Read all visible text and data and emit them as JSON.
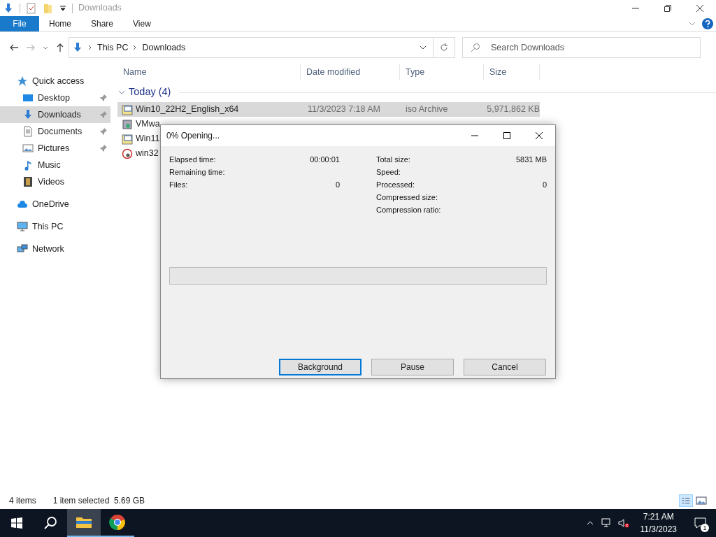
{
  "window": {
    "title": "Downloads"
  },
  "ribbon_tabs": [
    {
      "label": "File",
      "selected": true
    },
    {
      "label": "Home",
      "selected": false
    },
    {
      "label": "Share",
      "selected": false
    },
    {
      "label": "View",
      "selected": false
    }
  ],
  "breadcrumb": [
    "This PC",
    "Downloads"
  ],
  "search": {
    "placeholder": "Search Downloads"
  },
  "sidebar": {
    "items": [
      {
        "label": "Quick access",
        "kind": "star",
        "selected": false,
        "pinned": false,
        "children": [
          {
            "label": "Desktop",
            "kind": "desktop",
            "selected": false,
            "pinned": true
          },
          {
            "label": "Downloads",
            "kind": "download",
            "selected": true,
            "pinned": true
          },
          {
            "label": "Documents",
            "kind": "document",
            "selected": false,
            "pinned": true
          },
          {
            "label": "Pictures",
            "kind": "pictures",
            "selected": false,
            "pinned": true
          },
          {
            "label": "Music",
            "kind": "music",
            "selected": false,
            "pinned": false
          },
          {
            "label": "Videos",
            "kind": "video",
            "selected": false,
            "pinned": false
          }
        ]
      },
      {
        "label": "OneDrive",
        "kind": "cloud",
        "selected": false,
        "pinned": false
      },
      {
        "label": "This PC",
        "kind": "pc",
        "selected": false,
        "pinned": false
      },
      {
        "label": "Network",
        "kind": "network",
        "selected": false,
        "pinned": false
      }
    ]
  },
  "table": {
    "columns": [
      "Name",
      "Date modified",
      "Type",
      "Size"
    ],
    "group": "Today (4)",
    "rows": [
      {
        "kind": "iso",
        "selected": true,
        "cells": [
          "Win10_22H2_English_x64",
          "11/3/2023 7:18 AM",
          "iso Archive",
          "5,971,862 KB"
        ]
      },
      {
        "kind": "app",
        "selected": false,
        "cells": [
          "VMwa"
        ]
      },
      {
        "kind": "iso",
        "selected": false,
        "cells": [
          "Win11"
        ]
      },
      {
        "kind": "disk",
        "selected": false,
        "cells": [
          "win32"
        ]
      }
    ]
  },
  "status_bar": {
    "items": "4 items",
    "selection": "1 item selected  5.69 GB"
  },
  "dialog": {
    "title": "0% Opening...",
    "left": [
      {
        "label": "Elapsed time:",
        "value": "00:00:01"
      },
      {
        "label": "Remaining time:"
      },
      {
        "label": "Files:",
        "value": "0"
      }
    ],
    "right": [
      {
        "label": "Total size:",
        "value": "5831 MB"
      },
      {
        "label": "Speed:"
      },
      {
        "label": "Processed:",
        "value": "0"
      },
      {
        "label": "Compressed size:"
      },
      {
        "label": "Compression ratio:"
      }
    ],
    "progress": {
      "level": 0
    },
    "buttons": [
      {
        "label": "Background",
        "focused": true
      },
      {
        "label": "Pause",
        "focused": false
      },
      {
        "label": "Cancel",
        "focused": false
      }
    ]
  },
  "taskbar": {
    "time": "7:21 AM",
    "date": "11/3/2023",
    "notifications": "1"
  }
}
